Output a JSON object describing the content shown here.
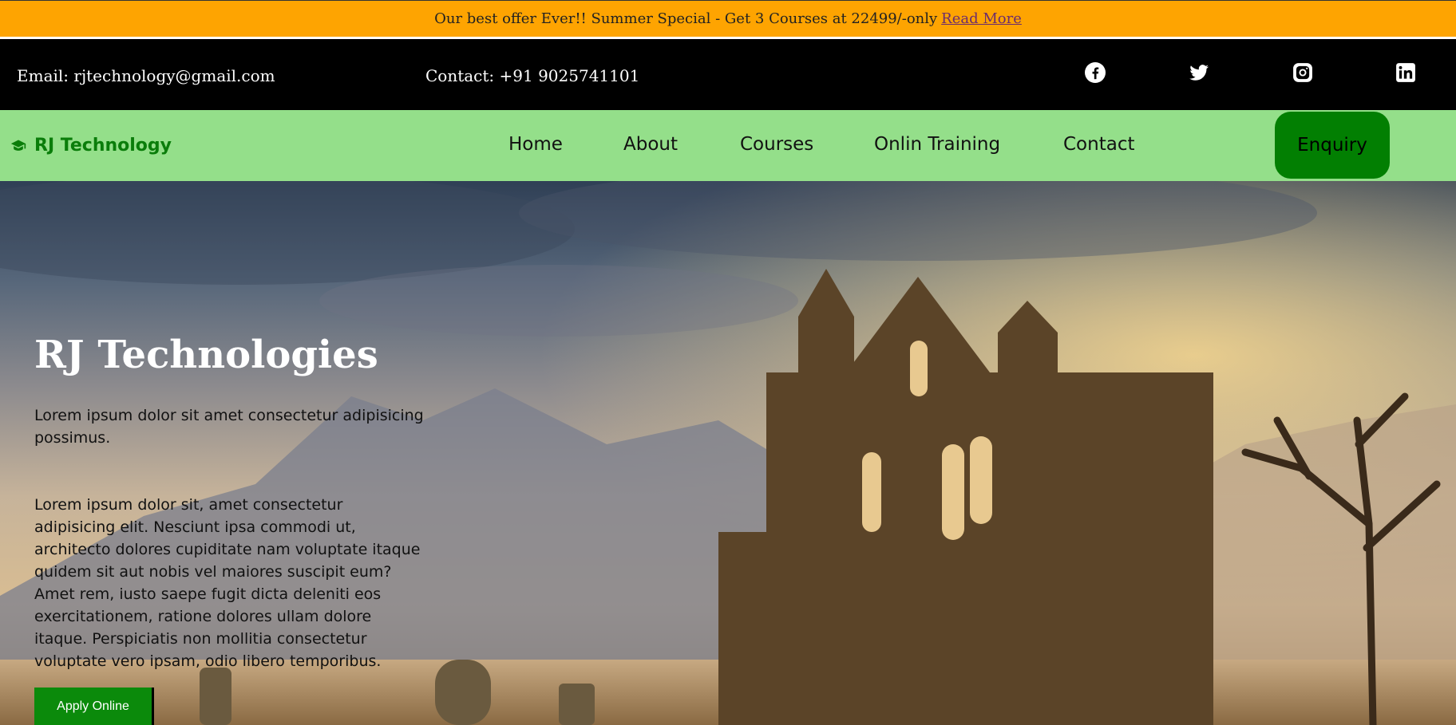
{
  "offer": {
    "text": "Our best offer Ever!! Summer Special - Get 3 Courses at 22499/-only",
    "link_label": "Read More"
  },
  "contact": {
    "email": "Email: rjtechnology@gmail.com",
    "phone": "Contact: +91 9025741101",
    "social_icons": [
      "facebook-icon",
      "twitter-icon",
      "instagram-icon",
      "linkedin-icon"
    ]
  },
  "nav": {
    "brand": "RJ Technology",
    "brand_icon": "graduation-cap-icon",
    "links": [
      "Home",
      "About",
      "Courses",
      "Onlin Training",
      "Contact"
    ],
    "enquiry": "Enquiry"
  },
  "hero": {
    "title": "RJ Technologies",
    "lead": "Lorem ipsum dolor sit amet consectetur adipisicing possimus.",
    "body": "Lorem ipsum dolor sit, amet consectetur adipisicing elit. Nesciunt ipsa commodi ut, architecto dolores cupiditate nam voluptate itaque quidem sit aut nobis vel maiores suscipit eum? Amet rem, iusto saepe fugit dicta deleniti eos exercitationem, ratione dolores ullam dolore itaque. Perspiciatis non mollitia consectetur voluptate vero ipsam, odio libero temporibus.",
    "apply": "Apply Online"
  },
  "colors": {
    "offer_bg": "#fea401",
    "nav_bg": "#94df8a",
    "brand": "#0a7d0a",
    "enquiry_bg": "#027f02",
    "apply_bg": "#0b8a0b"
  }
}
